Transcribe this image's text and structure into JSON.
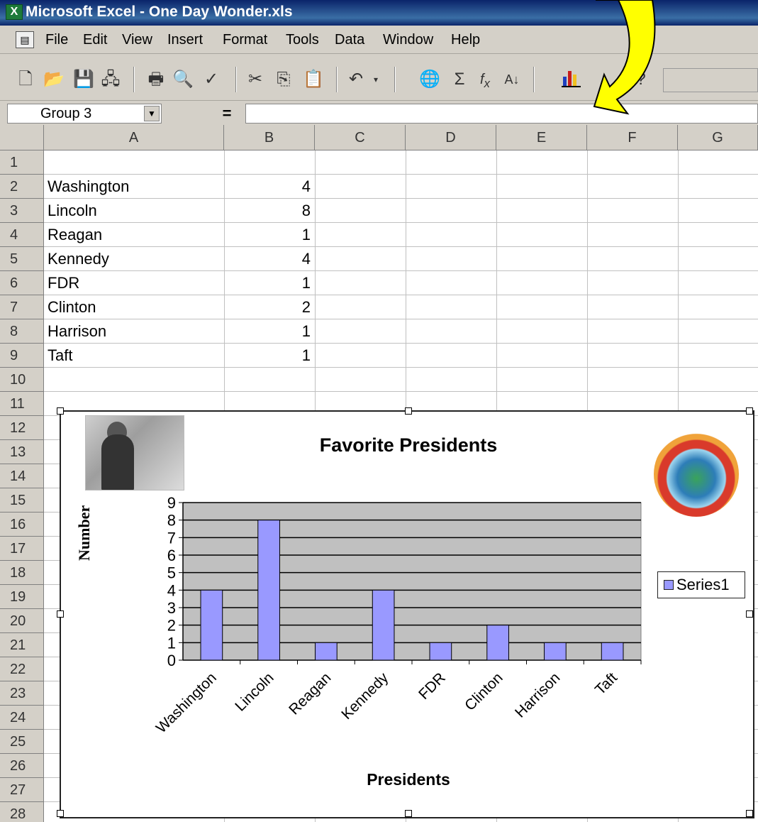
{
  "window": {
    "title": "Microsoft Excel - One Day Wonder.xls"
  },
  "menu": [
    "File",
    "Edit",
    "View",
    "Insert",
    "Format",
    "Tools",
    "Data",
    "Window",
    "Help"
  ],
  "toolbar": {
    "icons": [
      "new-icon",
      "open-icon",
      "save-icon",
      "permission-icon",
      "print-icon",
      "print-preview-icon",
      "spelling-icon",
      "cut-icon",
      "copy-icon",
      "paste-icon",
      "undo-icon",
      "hyperlink-icon",
      "autosum-icon",
      "function-icon",
      "sort-ascending-icon",
      "chart-wizard-icon"
    ],
    "highlight_color": "#ffff00"
  },
  "formula_bar": {
    "name_box": "Group 3",
    "equals": "=",
    "formula": ""
  },
  "sheet": {
    "columns": [
      "A",
      "B",
      "C",
      "D",
      "E",
      "F",
      "G"
    ],
    "rows": [
      "1",
      "2",
      "3",
      "4",
      "5",
      "6",
      "7",
      "8",
      "9",
      "10",
      "11",
      "12",
      "13",
      "14",
      "15",
      "16",
      "17",
      "18",
      "19",
      "20",
      "21",
      "22",
      "23",
      "24",
      "25",
      "26",
      "27",
      "28"
    ],
    "data": [
      {
        "name": "Washington",
        "value": "4"
      },
      {
        "name": "Lincoln",
        "value": "8"
      },
      {
        "name": "Reagan",
        "value": "1"
      },
      {
        "name": "Kennedy",
        "value": "4"
      },
      {
        "name": "FDR",
        "value": "1"
      },
      {
        "name": "Clinton",
        "value": "2"
      },
      {
        "name": "Harrison",
        "value": "1"
      },
      {
        "name": "Taft",
        "value": "1"
      }
    ]
  },
  "chart_data": {
    "type": "bar",
    "title": "Favorite Presidents",
    "xlabel": "Presidents",
    "ylabel": "Number",
    "categories": [
      "Washington",
      "Lincoln",
      "Reagan",
      "Kennedy",
      "FDR",
      "Clinton",
      "Harrison",
      "Taft"
    ],
    "series": [
      {
        "name": "Series1",
        "values": [
          4,
          8,
          1,
          4,
          1,
          2,
          1,
          1
        ]
      }
    ],
    "ylim": [
      0,
      9
    ],
    "yticks": [
      "0",
      "1",
      "2",
      "3",
      "4",
      "5",
      "6",
      "7",
      "8",
      "9"
    ],
    "grid": true,
    "legend": "right",
    "colors": {
      "bar": "#9999ff",
      "plot_area": "#c0c0c0"
    }
  }
}
